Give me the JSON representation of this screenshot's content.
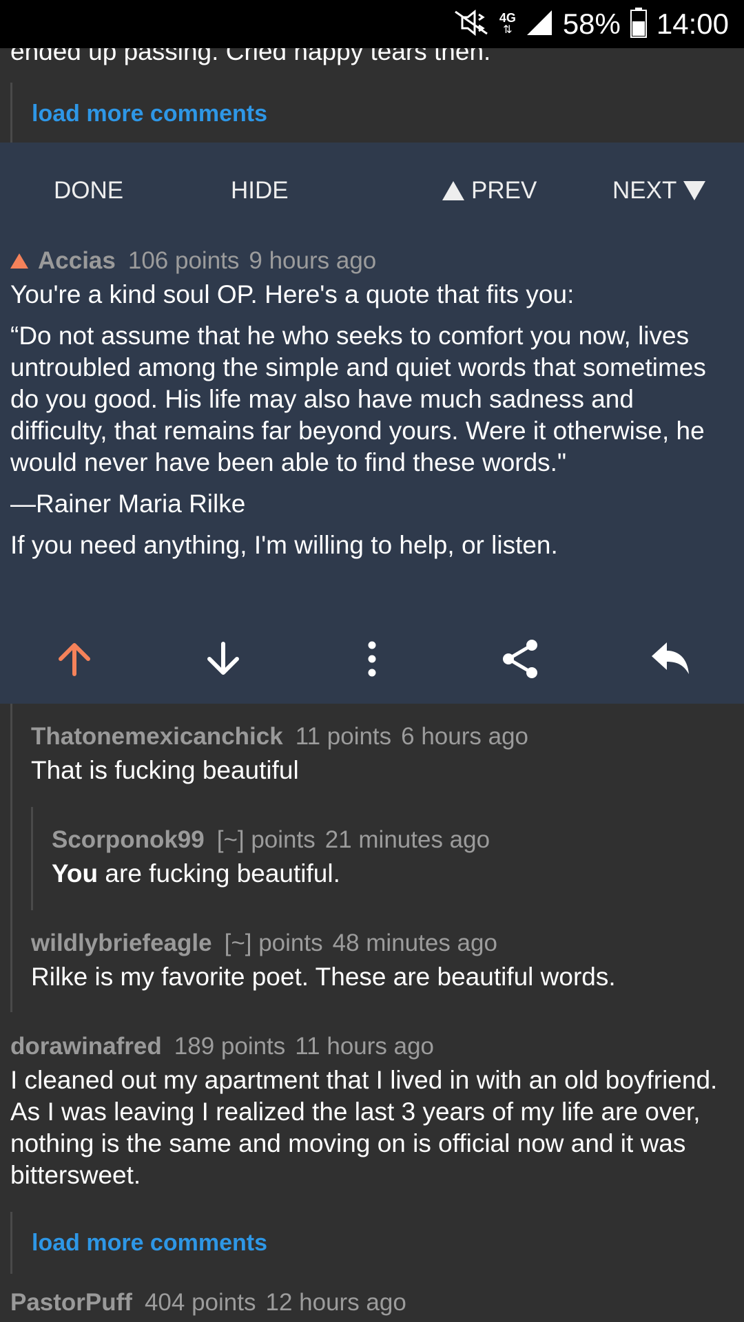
{
  "status_bar": {
    "network": "4G",
    "battery": "58%",
    "time": "14:00",
    "icons": [
      "mute-icon",
      "signal-icon",
      "battery-icon"
    ]
  },
  "truncated_text": "ended up passing. Cried happy tears then.",
  "load_more_label": "load more comments",
  "nav": {
    "done": "DONE",
    "hide": "HIDE",
    "prev": "PREV",
    "next": "NEXT"
  },
  "selected_comment": {
    "author": "Accias",
    "points": "106 points",
    "time": "9 hours ago",
    "paragraphs": [
      "You're a kind soul OP. Here's a quote that fits you:",
      "“Do not assume that he who seeks to comfort you now, lives untroubled among the simple and quiet words that sometimes do you good. His life may also have much sadness and difficulty, that remains far beyond yours. Were it otherwise, he would never have been able to find these words.\"",
      "—Rainer Maria Rilke",
      "If you need anything, I'm willing to help, or listen."
    ]
  },
  "actions": {
    "upvote_icon": "upvote-arrow-icon",
    "downvote_icon": "downvote-arrow-icon",
    "more_icon": "more-vertical-icon",
    "share_icon": "share-icon",
    "reply_icon": "reply-icon",
    "upvote_color": "#f5825a"
  },
  "comments": [
    {
      "author": "Thatonemexicanchick",
      "points": "11 points",
      "time": "6 hours ago",
      "body": "That is fucking beautiful"
    },
    {
      "author": "Scorponok99",
      "points": "[~] points",
      "time": "21 minutes ago",
      "body_bold": "You",
      "body": " are fucking beautiful."
    },
    {
      "author": "wildlybriefeagle",
      "points": "[~] points",
      "time": "48 minutes ago",
      "body": "Rilke is my favorite poet. These are beautiful words."
    },
    {
      "author": "dorawinafred",
      "points": "189 points",
      "time": "11 hours ago",
      "body": "I cleaned out my apartment that I lived in with an old boyfriend. As I was leaving I realized the last 3 years of my life are over, nothing is the same and moving on is official now and it was bittersweet."
    },
    {
      "author": "PastorPuff",
      "points": "404 points",
      "time": "12 hours ago"
    }
  ],
  "colors": {
    "background": "#303030",
    "selected_background": "#2f3a4c",
    "link": "#2e97e6",
    "upvote": "#f5825a"
  }
}
